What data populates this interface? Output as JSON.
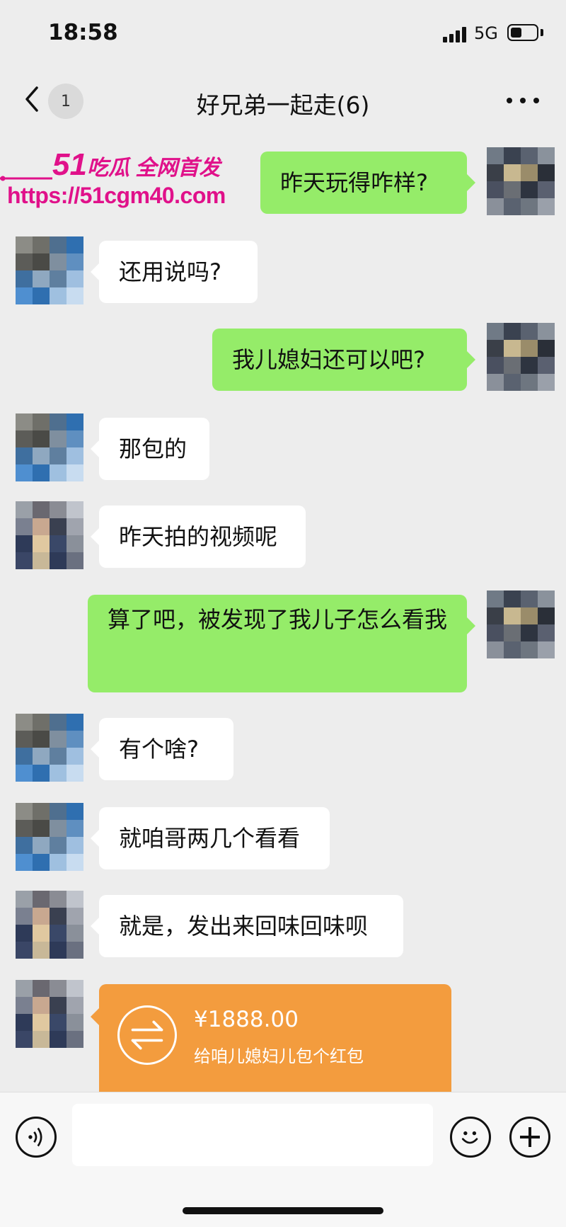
{
  "status_bar": {
    "time": "18:58",
    "network": "5G",
    "battery_level": 0.45
  },
  "nav": {
    "back_badge": "1",
    "title": "好兄弟一起走(6)"
  },
  "watermark": {
    "brand_number": "51",
    "brand_text": "吃瓜 全网首发",
    "url": "https://51cgm40.com"
  },
  "messages": [
    {
      "side": "out",
      "avatar": "friend-b",
      "text": "昨天玩得咋样?"
    },
    {
      "side": "in",
      "avatar": "friend-a",
      "text": "还用说吗?"
    },
    {
      "side": "out",
      "avatar": "friend-b",
      "text": "我儿媳妇还可以吧?"
    },
    {
      "side": "in",
      "avatar": "friend-a",
      "text": "那包的"
    },
    {
      "side": "in",
      "avatar": "friend-c",
      "text": "昨天拍的视频呢"
    },
    {
      "side": "out",
      "avatar": "friend-b",
      "text": "算了吧，被发现了我儿子怎么看我"
    },
    {
      "side": "in",
      "avatar": "friend-a",
      "text": "有个啥?"
    },
    {
      "side": "in",
      "avatar": "friend-a",
      "text": "就咱哥两几个看看"
    },
    {
      "side": "in",
      "avatar": "friend-c",
      "text": "就是，发出来回味回味呗"
    }
  ],
  "red_packet": {
    "amount": "¥1888.00",
    "note": "给咱儿媳妇儿包个红包"
  },
  "colors": {
    "outgoing_bubble": "#95ec69",
    "incoming_bubble": "#ffffff",
    "packet": "#f39c3e",
    "watermark": "#e0118a",
    "background": "#ededed"
  },
  "icons": [
    "back-icon",
    "more-icon",
    "voice-icon",
    "emoji-icon",
    "plus-icon",
    "transfer-icon"
  ]
}
